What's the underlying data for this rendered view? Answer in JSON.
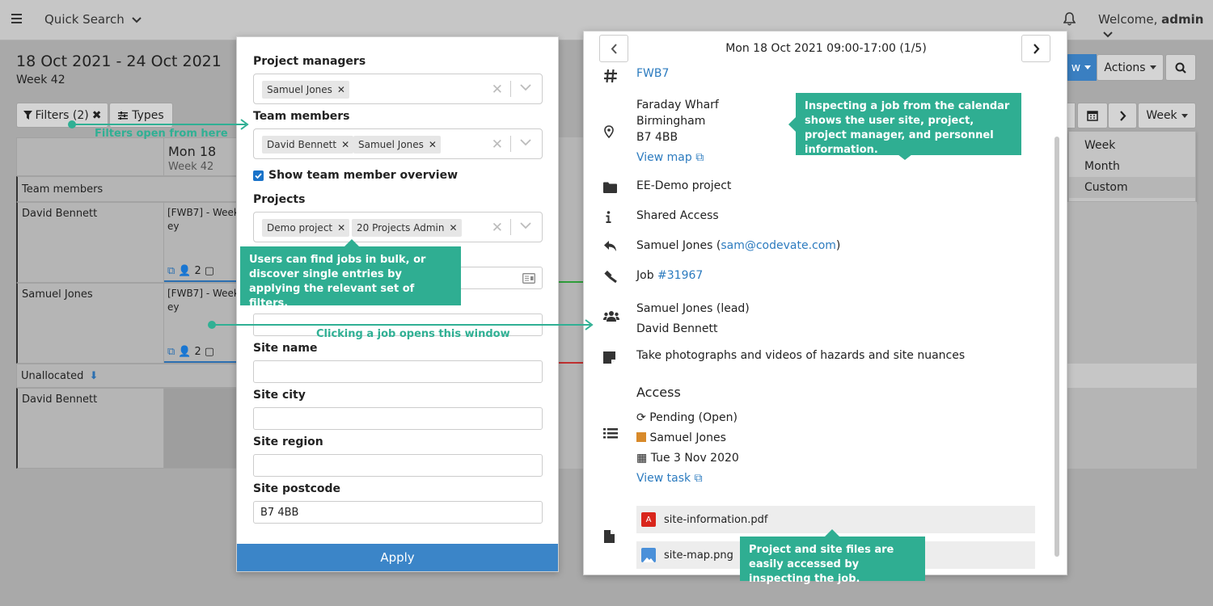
{
  "topbar": {
    "quick_search": "Quick Search",
    "welcome_prefix": "Welcome, ",
    "welcome_user": "admin"
  },
  "calendar": {
    "date_range": "18 Oct 2021 - 24 Oct 2021",
    "week_label": "Week 42",
    "filters_btn": "Filters (2)",
    "types_btn": "Types",
    "day_name": "Mon 18",
    "day_week": "Week 42",
    "actions_btn": "Actions",
    "view_btn_partial": "w",
    "view_select": "Week",
    "view_options": [
      "Week",
      "Month",
      "Custom"
    ],
    "section_team": "Team members",
    "section_unallocated": "Unallocated",
    "rows": [
      {
        "name": "David Bennett",
        "job_line1": "[FWB7] - Week",
        "job_line2": "ey",
        "count": "2"
      },
      {
        "name": "Samuel Jones",
        "job_line1": "[FWB7] - Week",
        "job_line2": "ey",
        "count": "2"
      },
      {
        "name": "David Bennett"
      }
    ]
  },
  "filter": {
    "pm_label": "Project managers",
    "pm_tags": [
      "Samuel Jones"
    ],
    "tm_label": "Team members",
    "tm_tags": [
      "David Bennett",
      "Samuel Jones"
    ],
    "overview_label": "Show team member overview",
    "overview_checked": true,
    "projects_label": "Projects",
    "project_tags": [
      "Demo project",
      "20 Projects Admin"
    ],
    "site_name_label": "Site name",
    "site_city_label": "Site city",
    "site_region_label": "Site region",
    "site_postcode_label": "Site postcode",
    "site_postcode_value": "B7 4BB",
    "apply": "Apply"
  },
  "job": {
    "header": "Mon 18 Oct 2021 09:00-17:00 (1/5)",
    "code": "FWB7",
    "address": [
      "Faraday Wharf",
      "Birmingham",
      "B7 4BB"
    ],
    "view_map": "View map",
    "project": "EE-Demo project",
    "access": "Shared Access",
    "manager_name": "Samuel Jones (",
    "manager_email": "sam@codevate.com",
    "manager_close": ")",
    "job_prefix": "Job ",
    "job_number": "#31967",
    "personnel": [
      "Samuel Jones (lead)",
      "David Bennett"
    ],
    "note": "Take photographs and videos of hazards and site nuances",
    "access_title": "Access",
    "task_status": "Pending (Open)",
    "task_user": "Samuel Jones",
    "task_date": "Tue 3 Nov 2020",
    "view_task": "View task",
    "files": [
      "site-information.pdf",
      "site-map.png"
    ]
  },
  "callouts": {
    "filters_open": "Filters open from here",
    "bulk": "Users can find jobs in bulk, or discover single entries by applying the relevant set of filters.",
    "clicking": "Clicking a job opens this window",
    "inspecting": "Inspecting a job from the calendar shows the user site, project, project manager, and personnel information.",
    "files": "Project and site files are easily accessed by inspecting the job."
  },
  "colors": {
    "accent_teal": "#2fae92",
    "apply_blue": "#3b85c8",
    "link_blue": "#2c7bbf"
  }
}
